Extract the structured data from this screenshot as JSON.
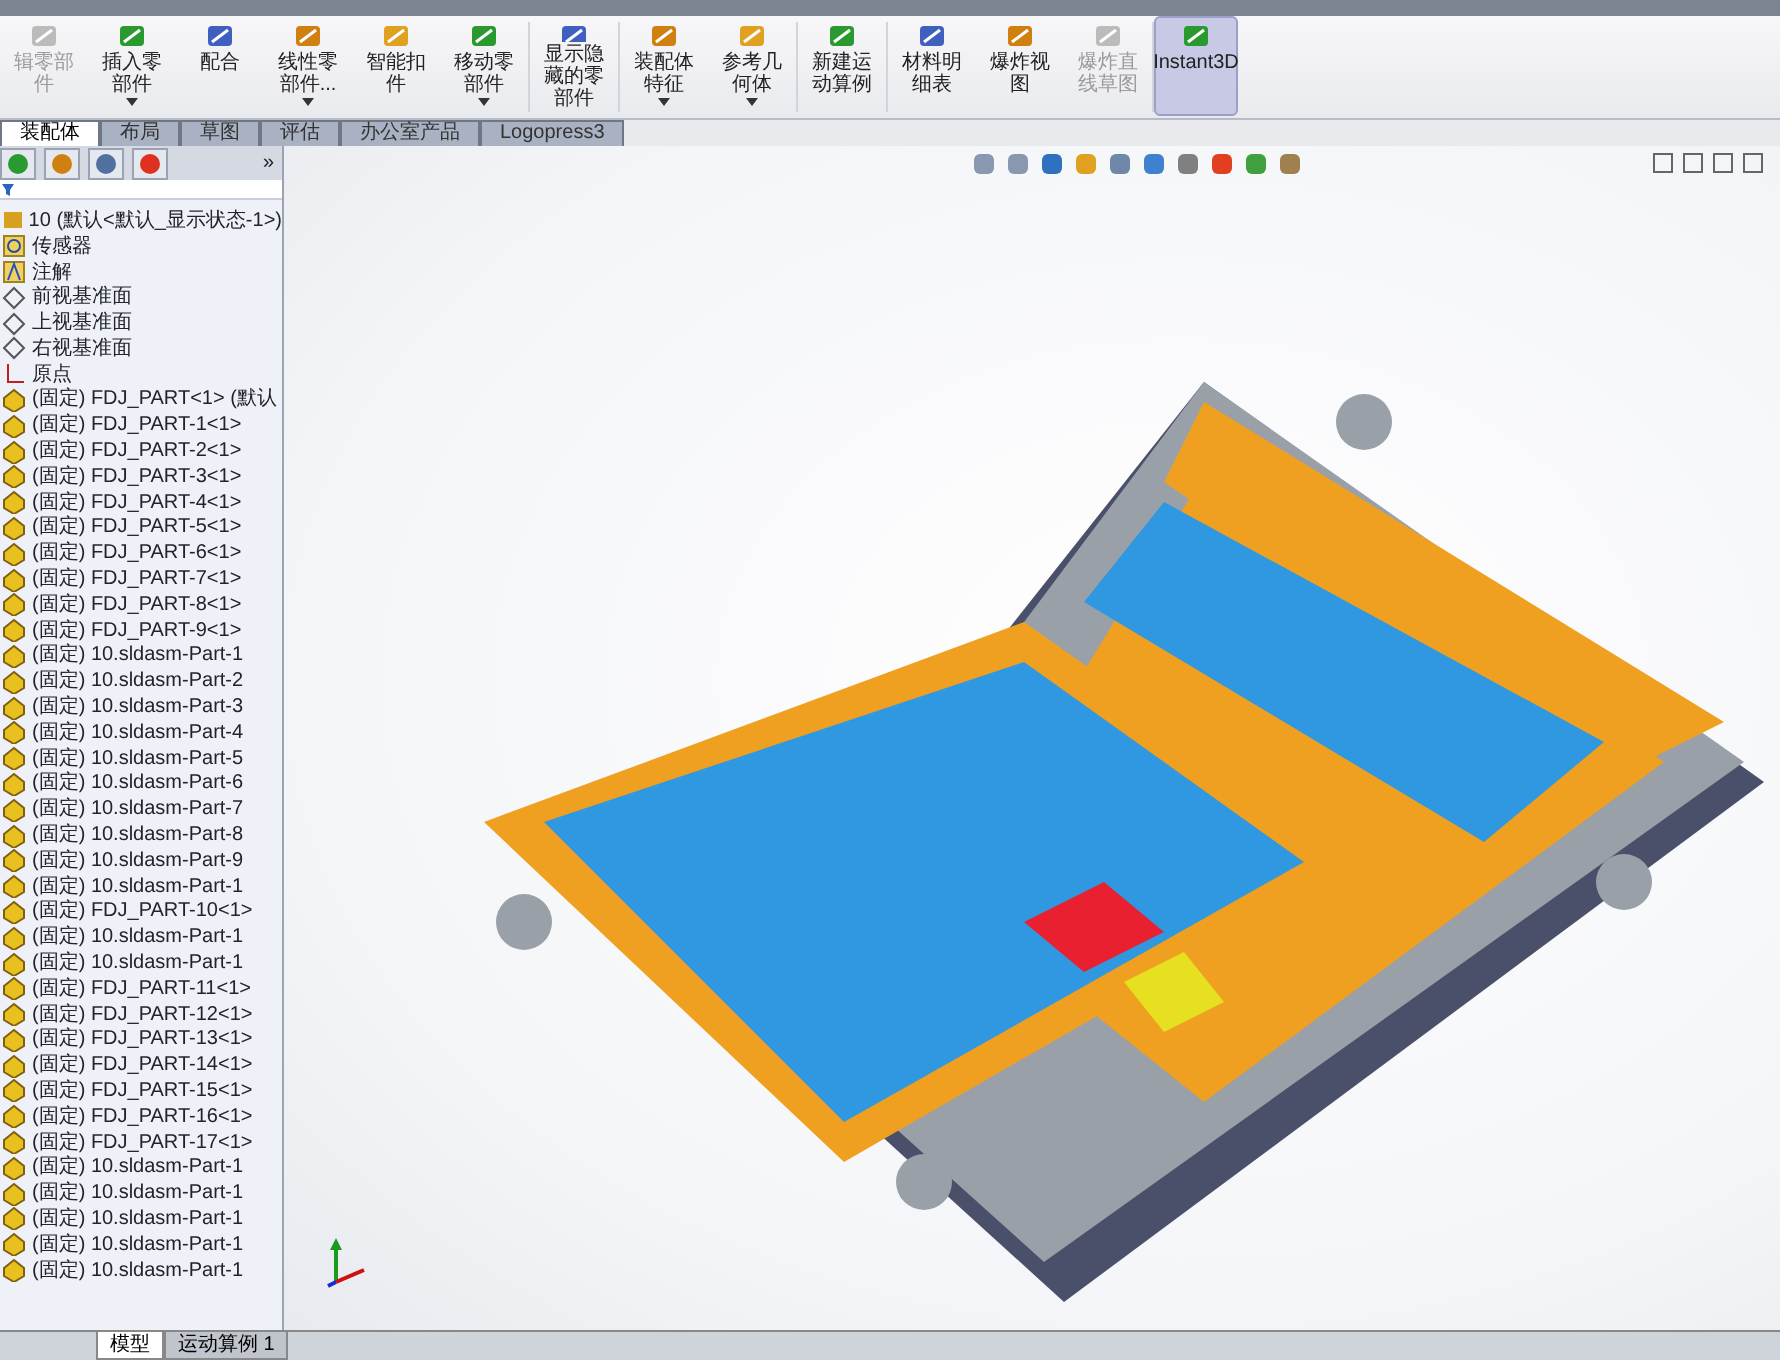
{
  "command_manager": {
    "buttons": [
      {
        "label": "辑零部件",
        "disabled": true,
        "selected": false,
        "dropdown": false
      },
      {
        "label": "插入零部件",
        "disabled": false,
        "selected": false,
        "dropdown": true
      },
      {
        "label": "配合",
        "disabled": false,
        "selected": false,
        "dropdown": false
      },
      {
        "label": "线性零部件...",
        "disabled": false,
        "selected": false,
        "dropdown": true
      },
      {
        "label": "智能扣件",
        "disabled": false,
        "selected": false,
        "dropdown": false
      },
      {
        "label": "移动零部件",
        "disabled": false,
        "selected": false,
        "dropdown": true
      },
      {
        "label": "显示隐藏的零部件",
        "disabled": false,
        "selected": false,
        "dropdown": false
      },
      {
        "label": "装配体特征",
        "disabled": false,
        "selected": false,
        "dropdown": true
      },
      {
        "label": "参考几何体",
        "disabled": false,
        "selected": false,
        "dropdown": true
      },
      {
        "label": "新建运动算例",
        "disabled": false,
        "selected": false,
        "dropdown": false
      },
      {
        "label": "材料明细表",
        "disabled": false,
        "selected": false,
        "dropdown": false
      },
      {
        "label": "爆炸视图",
        "disabled": false,
        "selected": false,
        "dropdown": false
      },
      {
        "label": "爆炸直线草图",
        "disabled": true,
        "selected": false,
        "dropdown": false
      },
      {
        "label": "Instant3D",
        "disabled": false,
        "selected": true,
        "dropdown": false
      }
    ],
    "tabs": [
      {
        "label": "装配体",
        "selected": true
      },
      {
        "label": "布局",
        "selected": false
      },
      {
        "label": "草图",
        "selected": false
      },
      {
        "label": "评估",
        "selected": false
      },
      {
        "label": "办公室产品",
        "selected": false
      },
      {
        "label": "Logopress3",
        "selected": false
      }
    ]
  },
  "feature_tree": {
    "panel_tabs_more": "»",
    "items": [
      {
        "kind": "root",
        "label": "10 (默认<默认_显示状态-1>)"
      },
      {
        "kind": "sensor",
        "label": "传感器"
      },
      {
        "kind": "annotation",
        "label": "注解"
      },
      {
        "kind": "plane",
        "label": "前视基准面"
      },
      {
        "kind": "plane",
        "label": "上视基准面"
      },
      {
        "kind": "plane",
        "label": "右视基准面"
      },
      {
        "kind": "origin",
        "label": "原点"
      },
      {
        "kind": "part",
        "label": "(固定) FDJ_PART<1> (默认"
      },
      {
        "kind": "part",
        "label": "(固定) FDJ_PART-1<1>"
      },
      {
        "kind": "part",
        "label": "(固定) FDJ_PART-2<1>"
      },
      {
        "kind": "part",
        "label": "(固定) FDJ_PART-3<1>"
      },
      {
        "kind": "part",
        "label": "(固定) FDJ_PART-4<1>"
      },
      {
        "kind": "part",
        "label": "(固定) FDJ_PART-5<1>"
      },
      {
        "kind": "part",
        "label": "(固定) FDJ_PART-6<1>"
      },
      {
        "kind": "part",
        "label": "(固定) FDJ_PART-7<1>"
      },
      {
        "kind": "part",
        "label": "(固定) FDJ_PART-8<1>"
      },
      {
        "kind": "part",
        "label": "(固定) FDJ_PART-9<1>"
      },
      {
        "kind": "part",
        "label": "(固定) 10.sldasm-Part-1"
      },
      {
        "kind": "part",
        "label": "(固定) 10.sldasm-Part-2"
      },
      {
        "kind": "part",
        "label": "(固定) 10.sldasm-Part-3"
      },
      {
        "kind": "part",
        "label": "(固定) 10.sldasm-Part-4"
      },
      {
        "kind": "part",
        "label": "(固定) 10.sldasm-Part-5"
      },
      {
        "kind": "part",
        "label": "(固定) 10.sldasm-Part-6"
      },
      {
        "kind": "part",
        "label": "(固定) 10.sldasm-Part-7"
      },
      {
        "kind": "part",
        "label": "(固定) 10.sldasm-Part-8"
      },
      {
        "kind": "part",
        "label": "(固定) 10.sldasm-Part-9"
      },
      {
        "kind": "part",
        "label": "(固定) 10.sldasm-Part-1"
      },
      {
        "kind": "part",
        "label": "(固定) FDJ_PART-10<1>"
      },
      {
        "kind": "part",
        "label": "(固定) 10.sldasm-Part-1"
      },
      {
        "kind": "part",
        "label": "(固定) 10.sldasm-Part-1"
      },
      {
        "kind": "part",
        "label": "(固定) FDJ_PART-11<1>"
      },
      {
        "kind": "part",
        "label": "(固定) FDJ_PART-12<1>"
      },
      {
        "kind": "part",
        "label": "(固定) FDJ_PART-13<1>"
      },
      {
        "kind": "part",
        "label": "(固定) FDJ_PART-14<1>"
      },
      {
        "kind": "part",
        "label": "(固定) FDJ_PART-15<1>"
      },
      {
        "kind": "part",
        "label": "(固定) FDJ_PART-16<1>"
      },
      {
        "kind": "part",
        "label": "(固定) FDJ_PART-17<1>"
      },
      {
        "kind": "part",
        "label": "(固定) 10.sldasm-Part-1"
      },
      {
        "kind": "part",
        "label": "(固定) 10.sldasm-Part-1"
      },
      {
        "kind": "part",
        "label": "(固定) 10.sldasm-Part-1"
      },
      {
        "kind": "part",
        "label": "(固定) 10.sldasm-Part-1"
      },
      {
        "kind": "part",
        "label": "(固定) 10.sldasm-Part-1"
      }
    ]
  },
  "bottom_tabs": [
    {
      "label": "模型",
      "selected": true
    },
    {
      "label": "运动算例 1",
      "selected": false
    }
  ]
}
